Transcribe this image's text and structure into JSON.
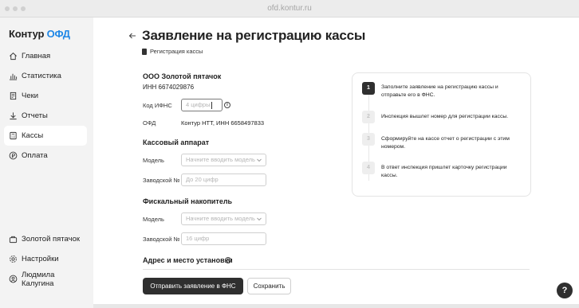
{
  "window": {
    "url": "ofd.kontur.ru"
  },
  "logo": {
    "brand": "Контур",
    "product": "ОФД"
  },
  "sidebar": {
    "items": [
      {
        "label": "Главная",
        "icon": "home-icon"
      },
      {
        "label": "Статистика",
        "icon": "chart-icon"
      },
      {
        "label": "Чеки",
        "icon": "receipt-icon"
      },
      {
        "label": "Отчеты",
        "icon": "download-icon"
      },
      {
        "label": "Кассы",
        "icon": "cash-register-icon",
        "active": true
      },
      {
        "label": "Оплата",
        "icon": "ruble-icon"
      }
    ],
    "bottom": [
      {
        "label": "Золотой пятачок",
        "icon": "organization-icon"
      },
      {
        "label": "Настройки",
        "icon": "gear-icon"
      },
      {
        "label": "Людмила Калугина",
        "icon": "user-icon"
      }
    ]
  },
  "page": {
    "title": "Заявление на регистрацию кассы",
    "breadcrumb": "Регистрация кассы"
  },
  "org": {
    "name": "ООО Золотой пятачок",
    "inn": "ИНН 6674029876"
  },
  "form": {
    "ifns_label": "Код ИФНС",
    "ifns_placeholder": "4 цифры",
    "ofd_label": "ОФД",
    "ofd_value": "Контур НТТ, ИНН 6658497833",
    "kkt_section": "Кассовый аппарат",
    "kkt_model_label": "Модель",
    "kkt_model_placeholder": "Начните вводить модель",
    "kkt_serial_label": "Заводской №",
    "kkt_serial_placeholder": "До 20 цифр",
    "fn_section": "Фискальный накопитель",
    "fn_model_label": "Модель",
    "fn_model_placeholder": "Начните вводить модель",
    "fn_serial_label": "Заводской №",
    "fn_serial_placeholder": "16 цифр",
    "address_section": "Адрес и место установки"
  },
  "buttons": {
    "submit": "Отправить заявление в ФНС",
    "save": "Сохранить",
    "help": "?"
  },
  "steps": [
    {
      "num": "1",
      "text": "Заполните заявление на регистрацию кассы и отправьте его в ФНС.",
      "active": true
    },
    {
      "num": "2",
      "text": "Инспекция вышлет номер для регистрации кассы.",
      "active": false
    },
    {
      "num": "3",
      "text": "Сформируйте на кассе отчет о регистрации с этим номером.",
      "active": false
    },
    {
      "num": "4",
      "text": "В ответ инспекция пришлет карточку регистрации кассы.",
      "active": false
    }
  ],
  "colors": {
    "accent": "#1f87e6",
    "primary_button": "#2f2f2f",
    "sidebar_bg": "#f3f3f3"
  }
}
